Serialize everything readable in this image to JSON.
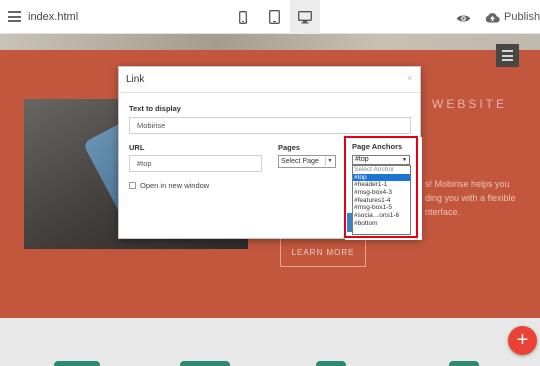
{
  "topbar": {
    "file_name": "index.html",
    "publish_label": "Publish",
    "icons": {
      "menu": "hamburger-menu-icon",
      "mobile": "mobile-device-icon",
      "tablet": "tablet-device-icon",
      "desktop": "desktop-device-icon",
      "preview": "eye-icon",
      "publish": "cloud-upload-icon"
    },
    "active_device": "desktop"
  },
  "hero": {
    "title_fragment": "WEBSITE",
    "text_lines": [
      "s! Mobirise helps you",
      "ding you with a flexible",
      "nterface."
    ],
    "button_label": "LEARN MORE",
    "background_color": "#c2573d"
  },
  "dialog": {
    "title": "Link",
    "close_glyph": "×",
    "text_to_display_label": "Text to display",
    "text_to_display_value": "Mobirise",
    "url_label": "URL",
    "url_value": "#top",
    "new_window_label": "Open in new window",
    "new_window_checked": false,
    "pages_label": "Pages",
    "pages_selected": "Select Page",
    "anchors_label": "Page Anchors",
    "anchors_selected": "#top",
    "anchors_options": [
      "Select Anchor",
      "#top",
      "#header1-1",
      "#msg-box4-3",
      "#features1-4",
      "#msg-box1-5",
      "#socia…ons1-6",
      "#bottom"
    ],
    "highlight_color": "#e4001b"
  },
  "fab": {
    "label": "+",
    "color": "#ea4336"
  }
}
